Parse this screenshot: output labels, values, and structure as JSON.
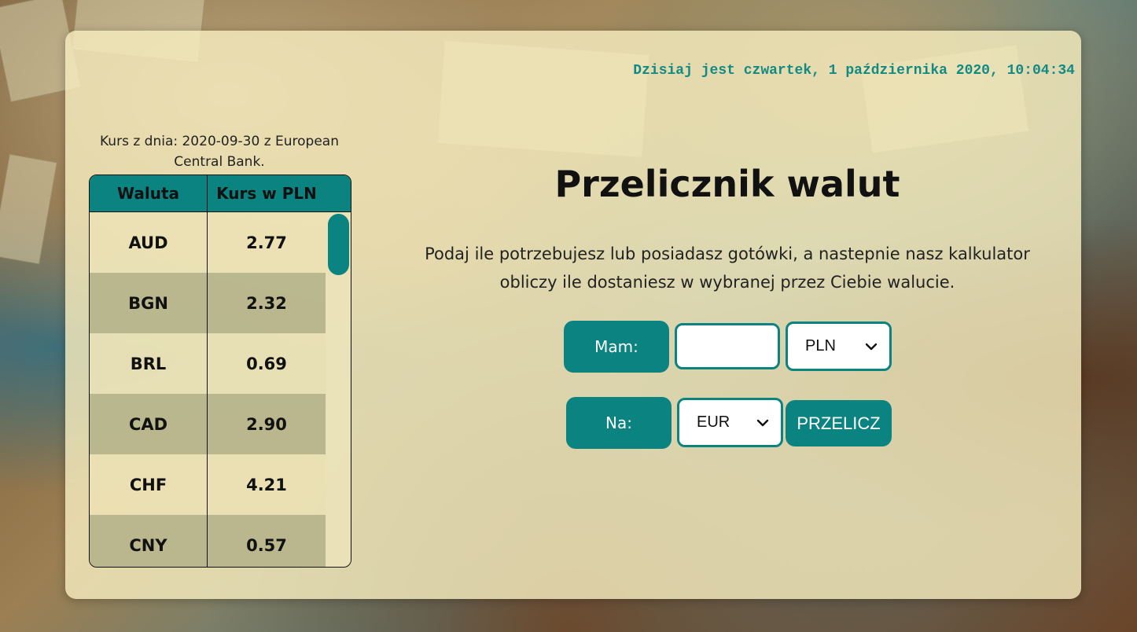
{
  "header": {
    "datetime": "Dzisiaj jest czwartek, 1 października 2020, 10:04:34"
  },
  "rates": {
    "caption": "Kurs z dnia: 2020-09-30 z European Central Bank.",
    "columns": [
      "Waluta",
      "Kurs w PLN"
    ],
    "rows": [
      {
        "currency": "AUD",
        "rate": "2.77"
      },
      {
        "currency": "BGN",
        "rate": "2.32"
      },
      {
        "currency": "BRL",
        "rate": "0.69"
      },
      {
        "currency": "CAD",
        "rate": "2.90"
      },
      {
        "currency": "CHF",
        "rate": "4.21"
      },
      {
        "currency": "CNY",
        "rate": "0.57"
      }
    ]
  },
  "converter": {
    "title": "Przelicznik walut",
    "description": "Podaj ile potrzebujesz lub posiadasz gotówki, a nastepnie nasz kalkulator obliczy ile dostaniesz w wybranej przez Ciebie walucie.",
    "have_label": "Mam:",
    "amount_value": "",
    "from_currency": "PLN",
    "to_label": "Na:",
    "to_currency": "EUR",
    "convert_label": "PRZELICZ"
  },
  "icons": {
    "select_arrow": "chevron-down-icon"
  },
  "colors": {
    "accent": "#0b8481",
    "datetime": "#128a84"
  }
}
